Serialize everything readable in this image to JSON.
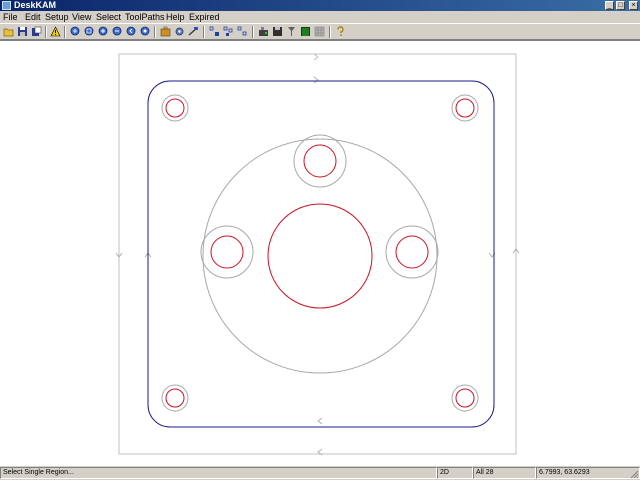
{
  "window": {
    "title": "DeskKAM",
    "minimize": "_",
    "maximize": "□",
    "close": "×"
  },
  "menu": [
    "File",
    "Edit",
    "Setup",
    "View",
    "Select",
    "ToolPaths",
    "Help",
    "Expired"
  ],
  "toolbar": {
    "groups": [
      {
        "name": "file",
        "items": [
          "open-folder-icon",
          "save-icon",
          "import-icon",
          "warning-icon"
        ]
      },
      {
        "name": "zoom",
        "items": [
          "zoom-all-icon",
          "zoom-window-icon",
          "zoom-in-icon",
          "zoom-out-icon",
          "zoom-previous-icon",
          "zoom-extents-icon"
        ]
      },
      {
        "name": "tools",
        "items": [
          "toolbox-icon",
          "settings-icon",
          "cut-icon"
        ]
      },
      {
        "name": "select",
        "items": [
          "select-single-icon",
          "select-chain-icon",
          "select-group-icon"
        ]
      },
      {
        "name": "output",
        "items": [
          "machine-icon",
          "disk-icon",
          "drill-icon",
          "screen-icon",
          "grid-icon",
          "help-icon"
        ]
      }
    ]
  },
  "colors": {
    "part_outline": "#1a1a8c",
    "cut_path": "#cc1122",
    "tool_path": "#a8a8a8",
    "stock_border": "#c0c0c0"
  },
  "status": {
    "message": "Select Single Region...",
    "mode": "2D",
    "selection": "All 28",
    "coordinates": "6.7993, 63.6293"
  }
}
